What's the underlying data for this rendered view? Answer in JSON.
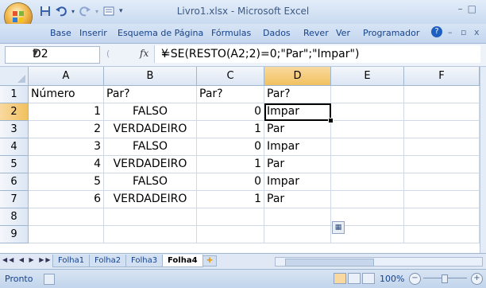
{
  "window": {
    "title": "Livro1.xlsx - Microsoft Excel",
    "controls": [
      "–",
      "□",
      "✕"
    ]
  },
  "ribbon_tabs": [
    "Base",
    "Inserir",
    "Esquema de Página",
    "Fórmulas",
    "Dados",
    "Rever",
    "Ver",
    "Programador"
  ],
  "formula_bar": {
    "name_box": "D2",
    "fx_label": "fx",
    "formula": "=SE(RESTO(A2;2)=0;\"Par\";\"Impar\")"
  },
  "columns": [
    "A",
    "B",
    "C",
    "D",
    "E",
    "F"
  ],
  "rows": [
    "1",
    "2",
    "3",
    "4",
    "5",
    "6",
    "7",
    "8",
    "9"
  ],
  "cells": {
    "A1": "Número",
    "B1": "Par?",
    "C1": "Par?",
    "D1": "Par?",
    "A2": "1",
    "B2": "FALSO",
    "C2": "0",
    "D2": "Impar",
    "A3": "2",
    "B3": "VERDADEIRO",
    "C3": "1",
    "D3": "Par",
    "A4": "3",
    "B4": "FALSO",
    "C4": "0",
    "D4": "Impar",
    "A5": "4",
    "B5": "VERDADEIRO",
    "C5": "1",
    "D5": "Par",
    "A6": "5",
    "B6": "FALSO",
    "C6": "0",
    "D6": "Impar",
    "A7": "6",
    "B7": "VERDADEIRO",
    "C7": "1",
    "D7": "Par"
  },
  "selected_cell": "D2",
  "sheet_tabs": [
    "Folha1",
    "Folha2",
    "Folha3",
    "Folha4"
  ],
  "active_sheet": "Folha4",
  "status": {
    "ready": "Pronto",
    "zoom": "100%"
  },
  "colors": {
    "ribbon_text": "#15428b",
    "selected_header": "#f1c15f",
    "grid_line": "#d0d7e5"
  }
}
